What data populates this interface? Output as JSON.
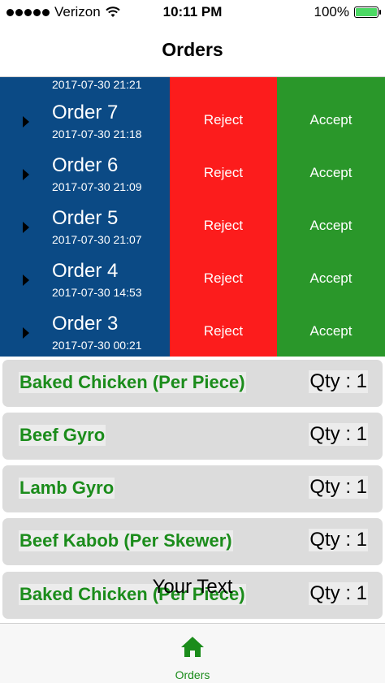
{
  "status_bar": {
    "carrier": "Verizon",
    "time": "10:11 PM",
    "battery_percent": "100%",
    "battery_level": 1.0
  },
  "nav": {
    "title": "Orders"
  },
  "orders_list": {
    "partial_top_date": "2017-07-30 21:21",
    "rows": [
      {
        "title": "Order 7",
        "date": "2017-07-30 21:18",
        "reject": "Reject",
        "accept": "Accept"
      },
      {
        "title": "Order 6",
        "date": "2017-07-30 21:09",
        "reject": "Reject",
        "accept": "Accept"
      },
      {
        "title": "Order 5",
        "date": "2017-07-30 21:07",
        "reject": "Reject",
        "accept": "Accept"
      },
      {
        "title": "Order 4",
        "date": "2017-07-30 14:53",
        "reject": "Reject",
        "accept": "Accept"
      },
      {
        "title": "Order 3",
        "date": "2017-07-30 00:21",
        "reject": "Reject",
        "accept": "Accept"
      }
    ]
  },
  "items": [
    {
      "name": "Baked Chicken (Per Piece)",
      "qty": "Qty : 1"
    },
    {
      "name": "Beef Gyro",
      "qty": "Qty : 1"
    },
    {
      "name": "Lamb Gyro",
      "qty": "Qty : 1"
    },
    {
      "name": "Beef Kabob (Per Skewer)",
      "qty": "Qty : 1"
    },
    {
      "name": "Baked Chicken (Per Piece)",
      "qty": "Qty : 1"
    }
  ],
  "overlay": {
    "text": "Your Text"
  },
  "tab_bar": {
    "tabs": [
      {
        "label": "Orders",
        "icon": "home-icon",
        "active": true
      }
    ]
  },
  "colors": {
    "order_bg": "#0b4a85",
    "reject_bg": "#fc1c1c",
    "accept_bg": "#2a972a",
    "item_text": "#1b8c1b",
    "tab_active": "#1b8c1b"
  }
}
